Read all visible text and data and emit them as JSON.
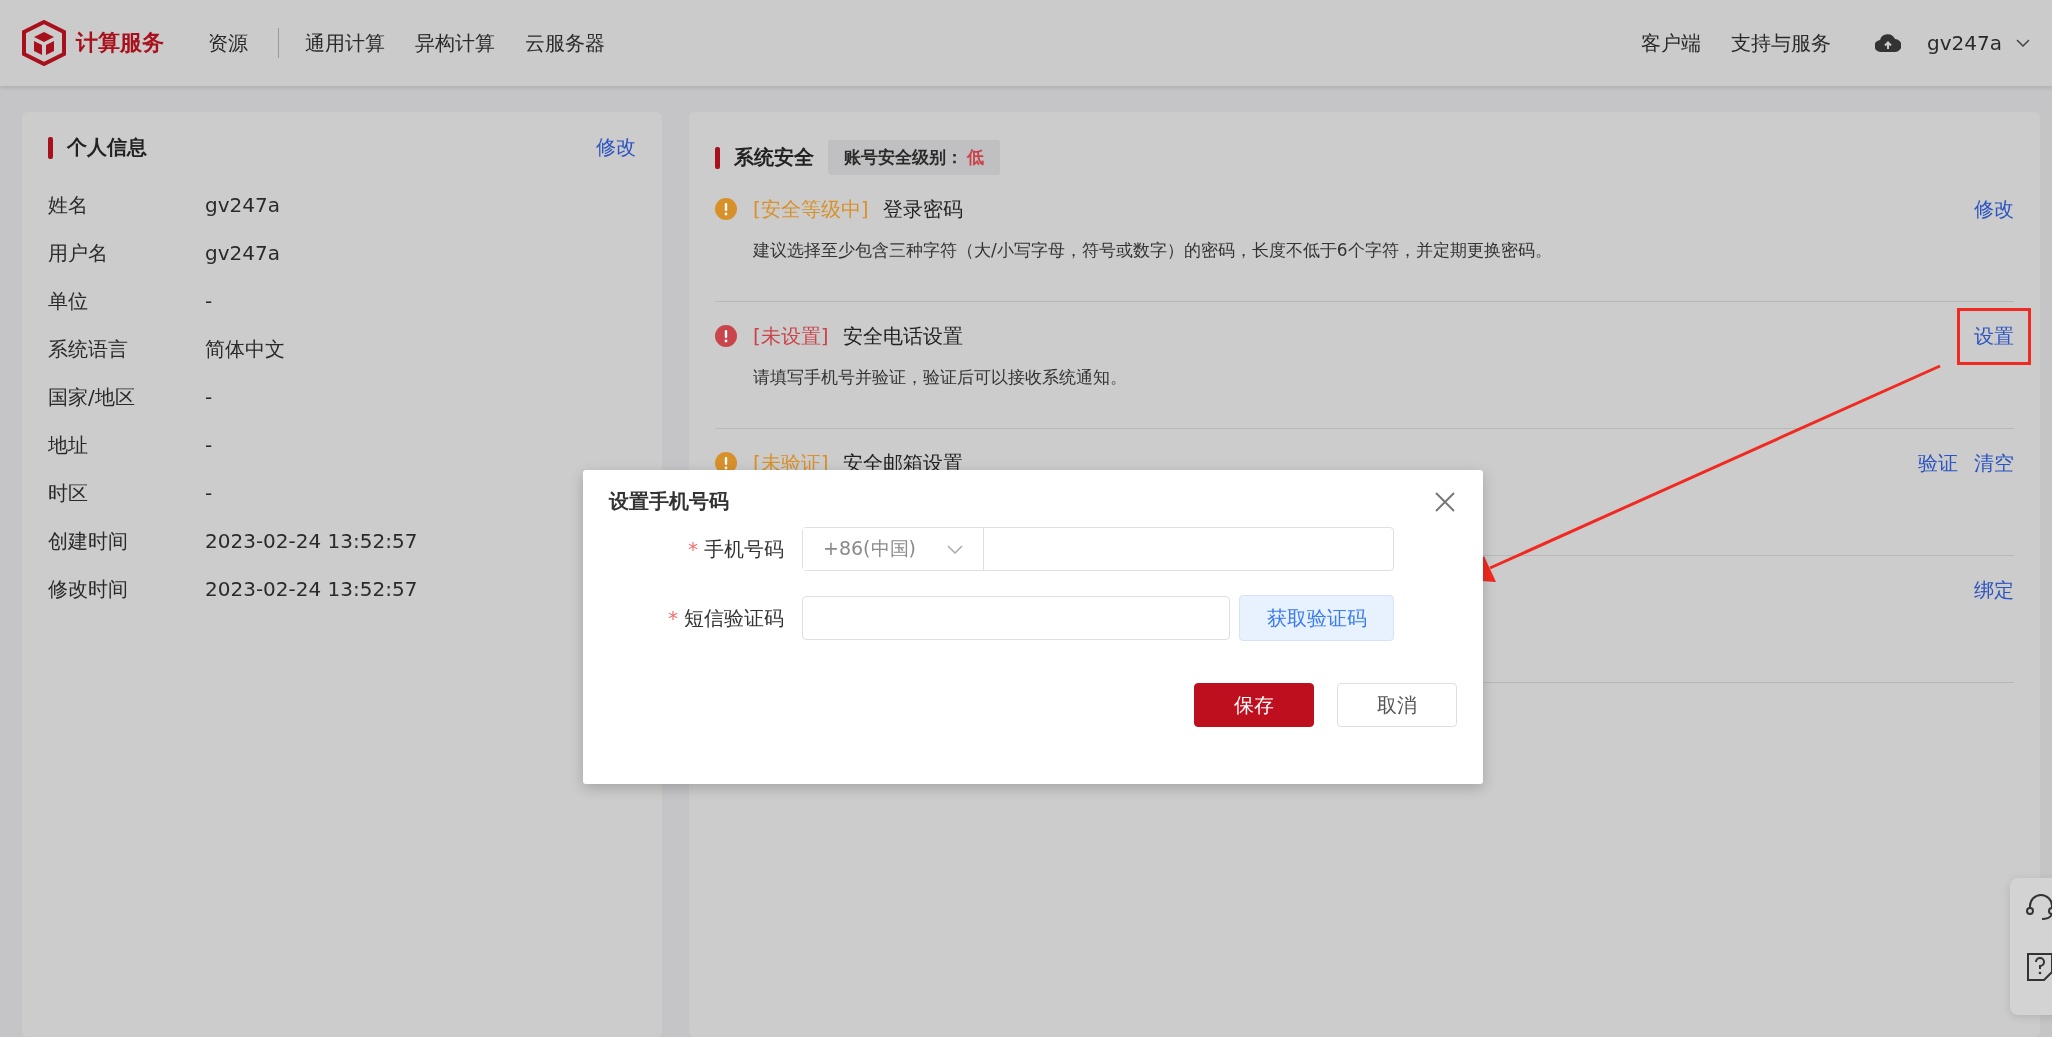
{
  "header": {
    "brand": "计算服务",
    "nav_primary": [
      "资源"
    ],
    "nav": [
      "通用计算",
      "异构计算",
      "云服务器"
    ],
    "links": [
      "客户端",
      "支持与服务"
    ],
    "user": "gv247a"
  },
  "personal": {
    "title": "个人信息",
    "edit": "修改",
    "fields": [
      {
        "label": "姓名",
        "value": "gv247a"
      },
      {
        "label": "用户名",
        "value": "gv247a"
      },
      {
        "label": "单位",
        "value": "-"
      },
      {
        "label": "系统语言",
        "value": "简体中文"
      },
      {
        "label": "国家/地区",
        "value": "-"
      },
      {
        "label": "地址",
        "value": "-"
      },
      {
        "label": "时区",
        "value": "-"
      },
      {
        "label": "创建时间",
        "value": "2023-02-24 13:52:57"
      },
      {
        "label": "修改时间",
        "value": "2023-02-24 13:52:57"
      }
    ]
  },
  "security": {
    "title": "系统安全",
    "level_label": "账号安全级别：",
    "level_value": "低",
    "items": [
      {
        "color": "#d8902a",
        "status": "[安全等级中]",
        "title": "登录密码",
        "description": "建议选择至少包含三种字符（大/小写字母，符号或数字）的密码，长度不低于6个字符，并定期更换密码。",
        "actions": [
          {
            "label": "修改",
            "highlighted": false
          }
        ]
      },
      {
        "color": "#c9454b",
        "status": "[未设置]",
        "title": "安全电话设置",
        "description": "请填写手机号并验证，验证后可以接收系统通知。",
        "actions": [
          {
            "label": "设置",
            "highlighted": true
          }
        ]
      },
      {
        "color": "#d8902a",
        "status": "[未验证]",
        "title": "安全邮箱设置",
        "actions": [
          {
            "label": "验证",
            "highlighted": false
          },
          {
            "label": "清空",
            "highlighted": false
          }
        ]
      },
      {
        "actions": [
          {
            "label": "绑定",
            "highlighted": false
          }
        ]
      }
    ]
  },
  "dialog": {
    "title": "设置手机号码",
    "required_mark": "*",
    "fields": [
      {
        "kind": "phone",
        "label": "手机号码",
        "required": true,
        "prefix": "+86(中国)"
      },
      {
        "kind": "code",
        "label": "短信验证码",
        "required": true,
        "button": "获取验证码"
      }
    ],
    "buttons": [
      {
        "kind": "primary",
        "label": "保存"
      },
      {
        "kind": "default",
        "label": "取消"
      }
    ]
  }
}
